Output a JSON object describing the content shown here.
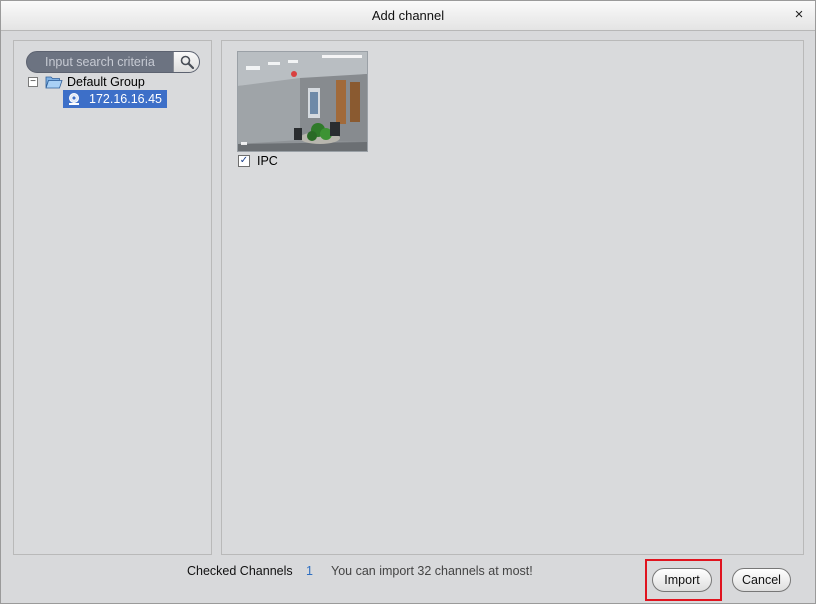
{
  "dialog": {
    "title": "Add channel",
    "close_glyph": "×"
  },
  "search": {
    "placeholder": "Input search criteria",
    "icon": "magnifier-icon"
  },
  "tree": {
    "expander_glyph": "−",
    "group_label": "Default Group",
    "group_icon": "open-folder-icon",
    "device_label": "172.16.16.45",
    "device_icon": "device-icon"
  },
  "channels": [
    {
      "label": "IPC",
      "checked": true,
      "check_glyph": "✓"
    }
  ],
  "footer": {
    "checked_label": "Checked Channels",
    "checked_count": "1",
    "limit_message": "You can import 32 channels at most!"
  },
  "buttons": {
    "import_label": "Import",
    "cancel_label": "Cancel"
  },
  "colors": {
    "selection": "#3d6fc8",
    "count_text": "#2f6fc1",
    "highlight_box": "#e0141f"
  }
}
